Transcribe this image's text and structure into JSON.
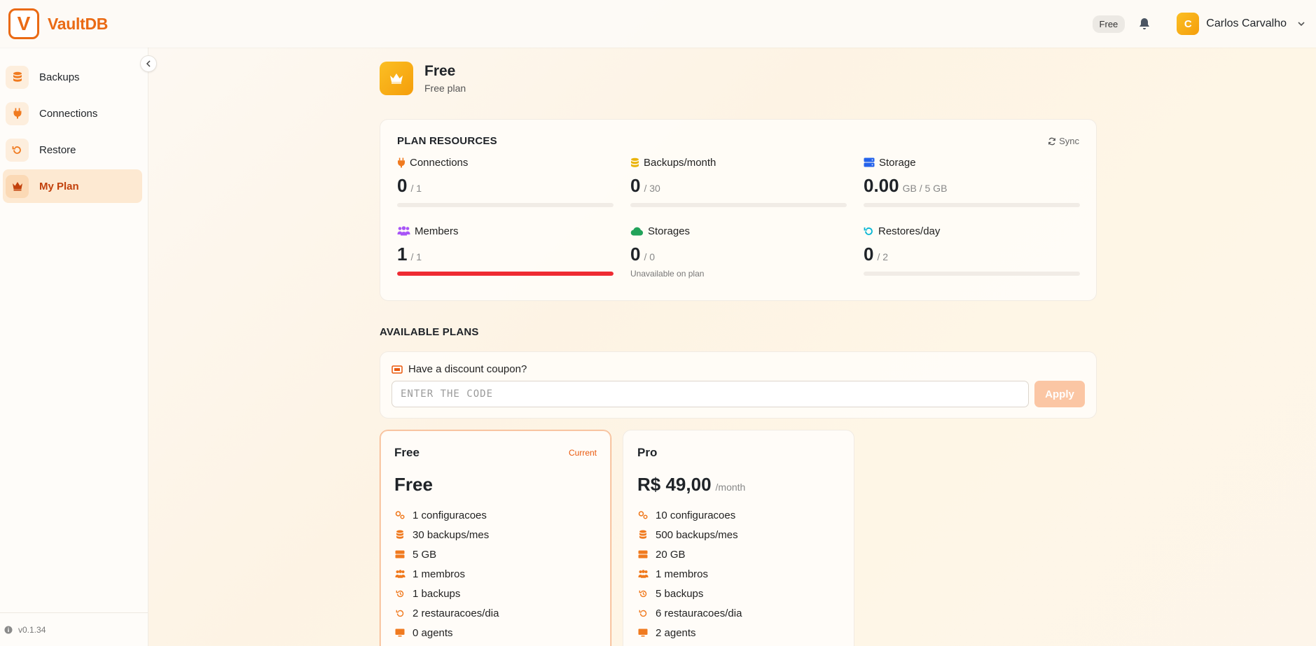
{
  "app": {
    "name": "VaultDB",
    "logo_letter": "V",
    "version": "v0.1.34"
  },
  "header": {
    "plan_pill": "Free",
    "user": {
      "initial": "C",
      "name": "Carlos Carvalho"
    }
  },
  "sidebar": {
    "items": [
      {
        "label": "Backups",
        "icon": "database-icon",
        "active": false
      },
      {
        "label": "Connections",
        "icon": "plug-icon",
        "active": false
      },
      {
        "label": "Restore",
        "icon": "restore-icon",
        "active": false
      },
      {
        "label": "My Plan",
        "icon": "crown-icon",
        "active": true
      }
    ]
  },
  "plan": {
    "title": "Free",
    "subtitle": "Free plan"
  },
  "resources": {
    "title": "PLAN RESOURCES",
    "sync_label": "Sync",
    "items": [
      {
        "label": "Connections",
        "value": "0",
        "max": "/ 1",
        "icon": "plug-icon",
        "usage": 0
      },
      {
        "label": "Backups/month",
        "value": "0",
        "max": "/ 30",
        "icon": "database-icon",
        "usage": 0
      },
      {
        "label": "Storage",
        "value": "0.00",
        "max": "GB / 5 GB",
        "icon": "hard-drive-icon",
        "usage": 0
      },
      {
        "label": "Members",
        "value": "1",
        "max": "/ 1",
        "icon": "users-icon",
        "usage": 1.0
      },
      {
        "label": "Storages",
        "value": "0",
        "max": "/ 0",
        "icon": "cloud-icon",
        "note": "Unavailable on plan"
      },
      {
        "label": "Restores/day",
        "value": "0",
        "max": "/ 2",
        "icon": "restore-icon",
        "usage": 0
      }
    ]
  },
  "available_plans": {
    "title": "AVAILABLE PLANS",
    "coupon": {
      "label": "Have a discount coupon?",
      "placeholder": "ENTER THE CODE",
      "apply_label": "Apply"
    },
    "plans": [
      {
        "name": "Free",
        "badge": "Current",
        "price": "Free",
        "period": "",
        "features": [
          {
            "icon": "config-icon",
            "text": "1 configuracoes"
          },
          {
            "icon": "database-icon",
            "text": "30 backups/mes"
          },
          {
            "icon": "hard-drive-icon",
            "text": "5 GB"
          },
          {
            "icon": "users-icon",
            "text": "1 membros"
          },
          {
            "icon": "history-icon",
            "text": "1 backups"
          },
          {
            "icon": "restore-icon",
            "text": "2 restauracoes/dia"
          },
          {
            "icon": "monitor-icon",
            "text": "0 agents"
          }
        ]
      },
      {
        "name": "Pro",
        "badge": "",
        "price": "R$ 49,00",
        "period": "/month",
        "features": [
          {
            "icon": "config-icon",
            "text": "10 configuracoes"
          },
          {
            "icon": "database-icon",
            "text": "500 backups/mes"
          },
          {
            "icon": "hard-drive-icon",
            "text": "20 GB"
          },
          {
            "icon": "users-icon",
            "text": "1 membros"
          },
          {
            "icon": "history-icon",
            "text": "5 backups"
          },
          {
            "icon": "restore-icon",
            "text": "6 restauracoes/dia"
          },
          {
            "icon": "monitor-icon",
            "text": "2 agents"
          }
        ]
      }
    ]
  },
  "colors": {
    "accent": "#ea6a14",
    "danger": "#ef2b33",
    "active_bg": "#fde9d2"
  }
}
